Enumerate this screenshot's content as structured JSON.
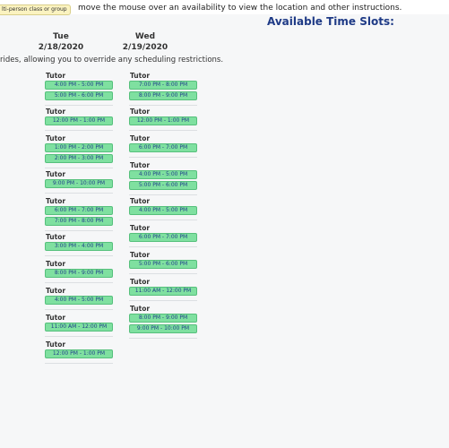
{
  "legend": {
    "tag_label": "lti-person class or group"
  },
  "instructions": "move the mouse over an availability to view the location and other instructions.",
  "panel_title": "Available Time Slots:",
  "override_note": "rides, allowing you to override any scheduling restrictions.",
  "days": [
    {
      "weekday": "Tue",
      "date": "2/18/2020",
      "blocks": [
        {
          "tutor": "Tutor",
          "slots": [
            "4:00 PM - 5:00 PM",
            "5:00 PM - 6:00 PM"
          ]
        },
        {
          "tutor": "Tutor",
          "slots": [
            "12:00 PM - 1:00 PM"
          ]
        },
        {
          "tutor": "Tutor",
          "slots": [
            "1:00 PM - 2:00 PM",
            "2:00 PM - 3:00 PM"
          ]
        },
        {
          "tutor": "Tutor",
          "slots": [
            "9:00 PM - 10:00 PM"
          ]
        },
        {
          "tutor": "Tutor",
          "slots": [
            "6:00 PM - 7:00 PM",
            "7:00 PM - 8:00 PM"
          ]
        },
        {
          "tutor": "Tutor",
          "slots": [
            "3:00 PM - 4:00 PM"
          ]
        },
        {
          "tutor": "Tutor",
          "slots": [
            "8:00 PM - 9:00 PM"
          ]
        },
        {
          "tutor": "Tutor",
          "slots": [
            "4:00 PM - 5:00 PM"
          ]
        },
        {
          "tutor": "Tutor",
          "slots": [
            "11:00 AM - 12:00 PM"
          ]
        },
        {
          "tutor": "Tutor",
          "slots": [
            "12:00 PM - 1:00 PM"
          ]
        }
      ]
    },
    {
      "weekday": "Wed",
      "date": "2/19/2020",
      "blocks": [
        {
          "tutor": "Tutor",
          "slots": [
            "7:00 PM - 8:00 PM",
            "8:00 PM - 9:00 PM"
          ]
        },
        {
          "tutor": "Tutor",
          "slots": [
            "12:00 PM - 1:00 PM"
          ]
        },
        {
          "tutor": "Tutor",
          "slots": [
            "6:00 PM - 7:00 PM"
          ]
        },
        {
          "tutor": "Tutor",
          "slots": [
            "4:00 PM - 5:00 PM",
            "5:00 PM - 6:00 PM"
          ]
        },
        {
          "tutor": "Tutor",
          "slots": [
            "4:00 PM - 5:00 PM"
          ]
        },
        {
          "tutor": "Tutor",
          "slots": [
            "6:00 PM - 7:00 PM"
          ]
        },
        {
          "tutor": "Tutor",
          "slots": [
            "5:00 PM - 6:00 PM"
          ]
        },
        {
          "tutor": "Tutor",
          "slots": [
            "11:00 AM - 12:00 PM"
          ]
        },
        {
          "tutor": "Tutor",
          "slots": [
            "8:00 PM - 9:00 PM",
            "9:00 PM - 10:00 PM"
          ]
        }
      ]
    }
  ],
  "colors": {
    "slot_fill": "#7fe0a0",
    "slot_border": "#56c07c",
    "slot_text": "#1f3f8a",
    "title": "#1e3a86",
    "legend_fill": "#fbf3c0"
  }
}
